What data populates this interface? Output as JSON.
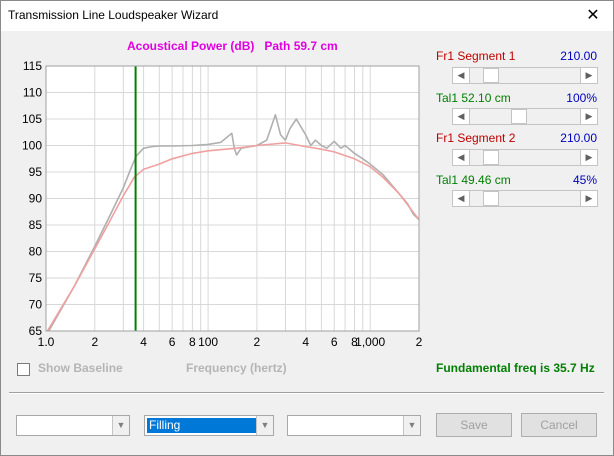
{
  "window": {
    "title": "Transmission Line Loudspeaker Wizard",
    "close_glyph": "✕"
  },
  "chart_header": "Acoustical Power (dB)   Path 59.7 cm",
  "chart_data": {
    "type": "line",
    "title": "Acoustical Power (dB)   Path 59.7 cm",
    "xlabel": "Frequency (hertz)",
    "ylabel": "",
    "x_scale": "log",
    "xlim": [
      10,
      2000
    ],
    "ylim": [
      65,
      115
    ],
    "y_ticks": [
      "115",
      "110",
      "105",
      "100",
      "95",
      "90",
      "85",
      "80",
      "75",
      "70",
      "65"
    ],
    "x_ticks": [
      {
        "value": 10,
        "label": "1.0"
      },
      {
        "value": 20,
        "label": "2"
      },
      {
        "value": 40,
        "label": "4"
      },
      {
        "value": 60,
        "label": "6"
      },
      {
        "value": 80,
        "label": "8"
      },
      {
        "value": 100,
        "label": "100"
      },
      {
        "value": 200,
        "label": "2"
      },
      {
        "value": 400,
        "label": "4"
      },
      {
        "value": 600,
        "label": "6"
      },
      {
        "value": 800,
        "label": "8"
      },
      {
        "value": 1000,
        "label": "1,000"
      },
      {
        "value": 2000,
        "label": "2"
      }
    ],
    "marker_freq": 35.7,
    "grid": true,
    "series": [
      {
        "color": "#b0b0b0",
        "x": [
          10.4,
          15,
          20,
          25,
          30,
          33,
          36,
          40,
          45,
          50,
          60,
          80,
          100,
          120,
          140,
          145,
          150,
          160,
          200,
          230,
          260,
          280,
          300,
          320,
          350,
          400,
          430,
          460,
          500,
          540,
          600,
          660,
          700,
          800,
          900,
          1000,
          1200,
          1500,
          1700,
          1850,
          2000
        ],
        "y": [
          65,
          73.5,
          81,
          87,
          92,
          95.3,
          98,
          99.5,
          99.8,
          99.9,
          99.9,
          100,
          100.2,
          100.6,
          102.3,
          99.5,
          98.2,
          99.5,
          100,
          101,
          105.8,
          102,
          101,
          103.2,
          105,
          102,
          100,
          101,
          100,
          99.5,
          100.8,
          99.5,
          100,
          98.5,
          97.5,
          96.5,
          94.5,
          91,
          89,
          87,
          86
        ]
      },
      {
        "color": "#f0a0a0",
        "x": [
          10.2,
          15,
          20,
          25,
          30,
          35,
          40,
          50,
          60,
          80,
          100,
          150,
          200,
          300,
          400,
          500,
          600,
          800,
          1000,
          1200,
          1500,
          2000
        ],
        "y": [
          65,
          73.5,
          80.5,
          86,
          90.5,
          94,
          95.5,
          96.5,
          97.5,
          98.5,
          99,
          99.5,
          100,
          100.5,
          99.8,
          99.3,
          98.8,
          97.5,
          96,
          94,
          91,
          86
        ]
      }
    ]
  },
  "right_panel": {
    "seg1_label": "Fr1  Segment 1",
    "seg1_value": "210.00",
    "seg1_slider_level": 0.14,
    "tal1a_label": "Tal1  52.10 cm",
    "tal1a_value": "100%",
    "tal1a_slider_level": 0.44,
    "seg2_label": "Fr1  Segment 2",
    "seg2_value": "210.00",
    "seg2_slider_level": 0.14,
    "tal1b_label": "Tal1  49.46 cm",
    "tal1b_value": "45%",
    "tal1b_slider_level": 0.14
  },
  "arrows": {
    "left": "◀",
    "right": "▶",
    "down": "▼"
  },
  "show_baseline_label": "Show Baseline",
  "frequency_label": "Frequency (hertz)",
  "fundamental_text": "Fundamental freq is 35.7 Hz",
  "combos": {
    "combo1_value": "",
    "combo2_value": "Filling",
    "combo3_value": ""
  },
  "buttons": {
    "save": "Save",
    "cancel": "Cancel"
  },
  "colors": {
    "title_magenta": "#e000e0",
    "segment_red": "#c00000",
    "value_blue": "#0000c0",
    "tal_green": "#008000",
    "marker_green": "#008000"
  }
}
